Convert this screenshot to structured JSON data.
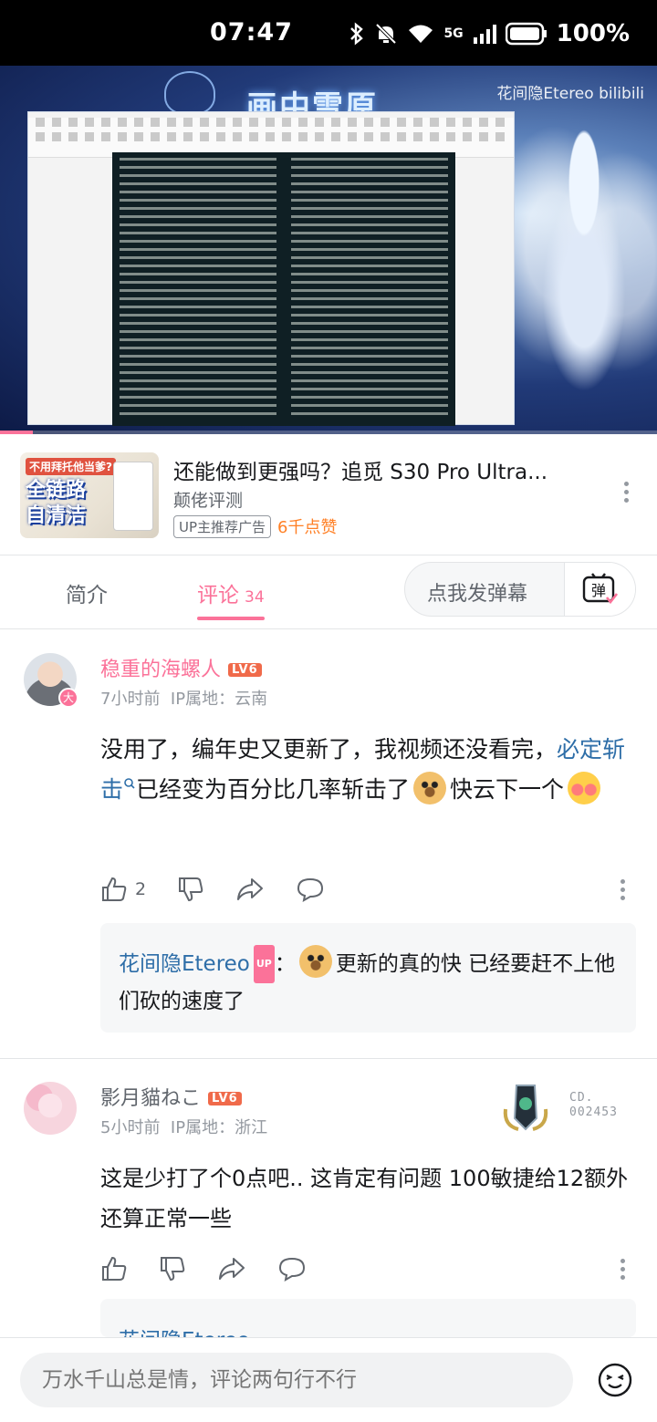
{
  "status_bar": {
    "time": "07:47",
    "network": "5G",
    "battery": "100%",
    "icons": [
      "bluetooth-icon",
      "mute-icon",
      "wifi-icon",
      "signal-icon",
      "battery-icon"
    ]
  },
  "player": {
    "logo_text": "画中雪原",
    "watermark": "花间隐Etereo bilibili",
    "progress": 0.05
  },
  "ad": {
    "title": "还能做到更强吗？追觅 S30 Pro Ultra...",
    "author": "颠佬评测",
    "tag": "UP主推荐广告",
    "likes": "6千点赞",
    "thumb_badge": "不用拜托他当爹?",
    "thumb_text": "全链路\n自清洁"
  },
  "tabs": {
    "intro": "简介",
    "comments": "评论",
    "comments_count": "34",
    "danmaku_placeholder": "点我发弹幕",
    "danmaku_button": "弹"
  },
  "comments": [
    {
      "user": "稳重的海螺人",
      "level": "LV6",
      "time": "7小时前",
      "location": "IP属地：云南",
      "text_a": "没用了，编年史又更新了，我视频还没看完，",
      "link": "必定斩击",
      "text_b": "已经变为百分比几率斩击了",
      "text_c": "快云下一个",
      "likes": "2",
      "reply": {
        "user": "花间隐Etereo",
        "up": "UP",
        "text": "更新的真的快 已经要赶不上他们砍的速度了"
      }
    },
    {
      "user": "影月貓ねこ",
      "level": "LV6",
      "time": "5小时前",
      "location": "IP属地：浙江",
      "medal_text": "CD.\n002453",
      "text": "这是少打了个0点吧.. 这肯定有问题 100敏捷给12额外还算正常一些",
      "reply_partial": "花间隐Etereo"
    }
  ],
  "input": {
    "placeholder": "万水千山总是情，评论两句行不行"
  },
  "colors": {
    "accent": "#fb7299",
    "link": "#2e6ea8",
    "level": "#f06a4a",
    "ad_likes": "#ff7f24"
  }
}
